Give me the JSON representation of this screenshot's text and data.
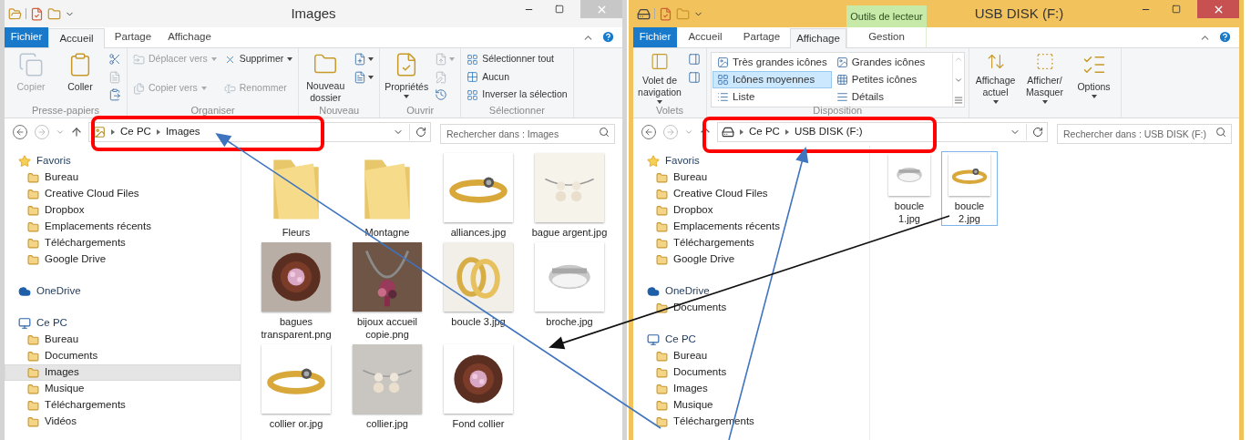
{
  "windows": [
    {
      "title": "Images",
      "active": false,
      "tabs": [
        {
          "label": "Fichier",
          "kind": "file",
          "selected": false
        },
        {
          "label": "Accueil",
          "kind": "normal",
          "selected": true
        },
        {
          "label": "Partage",
          "kind": "normal",
          "selected": false
        },
        {
          "label": "Affichage",
          "kind": "normal",
          "selected": false
        }
      ],
      "ribbon": [
        {
          "label": "Presse-papiers",
          "kind": "buttons",
          "items": [
            {
              "label": "Copier",
              "kind": "large",
              "disabled": true,
              "dropdown": false
            },
            {
              "label": "Coller",
              "kind": "large",
              "disabled": false,
              "dropdown": false
            },
            {
              "kind": "icon",
              "disabled": false,
              "dropdown": false
            },
            {
              "kind": "icon",
              "disabled": true,
              "dropdown": false
            },
            {
              "kind": "icon",
              "disabled": false,
              "dropdown": false
            }
          ]
        },
        {
          "label": "Organiser",
          "kind": "buttons",
          "items": [
            {
              "label": "Déplacer vers",
              "kind": "small",
              "disabled": true,
              "dropdown": true
            },
            {
              "label": "Copier vers",
              "kind": "small",
              "disabled": true,
              "dropdown": true
            },
            {
              "label": "Supprimer",
              "kind": "small",
              "disabled": false,
              "dropdown": true
            },
            {
              "label": "Renommer",
              "kind": "small",
              "disabled": true,
              "dropdown": false
            }
          ]
        },
        {
          "label": "Nouveau",
          "kind": "buttons",
          "items": [
            {
              "label": "Nouveau dossier",
              "kind": "large",
              "disabled": false,
              "dropdown": false
            },
            {
              "kind": "icon",
              "disabled": false,
              "dropdown": true
            },
            {
              "kind": "icon",
              "disabled": false,
              "dropdown": true
            }
          ]
        },
        {
          "label": "Ouvrir",
          "kind": "buttons",
          "items": [
            {
              "label": "Propriétés",
              "kind": "large",
              "disabled": false,
              "dropdown": true
            },
            {
              "kind": "icon",
              "disabled": true,
              "dropdown": true
            },
            {
              "kind": "icon",
              "disabled": true,
              "dropdown": false
            },
            {
              "kind": "icon",
              "disabled": false,
              "dropdown": false
            }
          ]
        },
        {
          "label": "Sélectionner",
          "kind": "buttons",
          "items": [
            {
              "label": "Sélectionner tout",
              "kind": "small",
              "disabled": false,
              "dropdown": false
            },
            {
              "label": "Aucun",
              "kind": "small",
              "disabled": false,
              "dropdown": false
            },
            {
              "label": "Inverser la sélection",
              "kind": "small",
              "disabled": false,
              "dropdown": false
            }
          ]
        }
      ],
      "address": {
        "crumbs": [
          "Ce PC",
          "Images"
        ]
      },
      "search": {
        "placeholder": "Rechercher dans : Images"
      },
      "nav": [
        {
          "label": "Favoris",
          "selected": false,
          "children": [
            {
              "label": "Bureau",
              "selected": false
            },
            {
              "label": "Creative Cloud Files",
              "selected": false
            },
            {
              "label": "Dropbox",
              "selected": false
            },
            {
              "label": "Emplacements récents",
              "selected": false
            },
            {
              "label": "Téléchargements",
              "selected": false
            },
            {
              "label": "Google Drive",
              "selected": false
            }
          ]
        },
        {
          "label": "OneDrive",
          "selected": false
        },
        {
          "label": "Ce PC",
          "selected": false,
          "children": [
            {
              "label": "Bureau",
              "selected": false
            },
            {
              "label": "Documents",
              "selected": false
            },
            {
              "label": "Images",
              "selected": true
            },
            {
              "label": "Musique",
              "selected": false
            },
            {
              "label": "Téléchargements",
              "selected": false
            },
            {
              "label": "Vidéos",
              "selected": false
            }
          ]
        }
      ],
      "files": [
        {
          "name": "Fleurs",
          "kind": "folder",
          "selected": false
        },
        {
          "name": "Montagne",
          "kind": "folder",
          "selected": false
        },
        {
          "name": "alliances.jpg",
          "kind": "picture",
          "selected": false
        },
        {
          "name": "bague argent.jpg",
          "kind": "picture",
          "selected": false
        },
        {
          "name": "bagues transparent.png",
          "kind": "picture",
          "selected": false
        },
        {
          "name": "bijoux accueil copie.png",
          "kind": "picture",
          "selected": false
        },
        {
          "name": "boucle 3.jpg",
          "kind": "picture",
          "selected": false
        },
        {
          "name": "broche.jpg",
          "kind": "picture",
          "selected": false
        },
        {
          "name": "collier or.jpg",
          "kind": "picture",
          "selected": false
        },
        {
          "name": "collier.jpg",
          "kind": "picture",
          "selected": false
        },
        {
          "name": "Fond collier",
          "kind": "picture",
          "selected": false
        }
      ]
    },
    {
      "title": "USB DISK (F:)",
      "active": true,
      "tabs": [
        {
          "label": "Fichier",
          "kind": "file",
          "selected": false
        },
        {
          "label": "Accueil",
          "kind": "normal",
          "selected": false
        },
        {
          "label": "Partage",
          "kind": "normal",
          "selected": false
        },
        {
          "label": "Affichage",
          "kind": "normal",
          "selected": true
        },
        {
          "label": "Gestion",
          "kind": "context",
          "context": "Outils de lecteur",
          "selected": false
        }
      ],
      "ribbon": [
        {
          "label": "Volets",
          "kind": "buttons",
          "items": [
            {
              "label": "Volet de navigation",
              "kind": "large",
              "disabled": false,
              "dropdown": true
            },
            {
              "kind": "icon",
              "disabled": false,
              "dropdown": false
            },
            {
              "kind": "icon",
              "disabled": false,
              "dropdown": false
            }
          ]
        },
        {
          "label": "Disposition",
          "kind": "gallery",
          "items": [
            {
              "label": "Très grandes icônes",
              "selected": false
            },
            {
              "label": "Grandes icônes",
              "selected": false
            },
            {
              "label": "Icônes moyennes",
              "selected": true
            },
            {
              "label": "Petites icônes",
              "selected": false
            },
            {
              "label": "Liste",
              "selected": false
            },
            {
              "label": "Détails",
              "selected": false
            }
          ]
        },
        {
          "kind": "buttons",
          "items": [
            {
              "label": "Affichage actuel",
              "kind": "large",
              "disabled": false,
              "dropdown": true
            },
            {
              "label": "Afficher/ Masquer",
              "kind": "large",
              "disabled": false,
              "dropdown": true
            },
            {
              "label": "Options",
              "kind": "large",
              "disabled": false,
              "dropdown": true
            }
          ]
        }
      ],
      "address": {
        "crumbs": [
          "Ce PC",
          "USB DISK (F:)"
        ]
      },
      "search": {
        "placeholder": "Rechercher dans : USB DISK (F:)"
      },
      "nav": [
        {
          "label": "Favoris",
          "selected": false,
          "children": [
            {
              "label": "Bureau",
              "selected": false
            },
            {
              "label": "Creative Cloud Files",
              "selected": false
            },
            {
              "label": "Dropbox",
              "selected": false
            },
            {
              "label": "Emplacements récents",
              "selected": false
            },
            {
              "label": "Téléchargements",
              "selected": false
            },
            {
              "label": "Google Drive",
              "selected": false
            }
          ]
        },
        {
          "label": "OneDrive",
          "selected": false,
          "children": [
            {
              "label": "Documents",
              "selected": false
            }
          ]
        },
        {
          "label": "Ce PC",
          "selected": false,
          "children": [
            {
              "label": "Bureau",
              "selected": false
            },
            {
              "label": "Documents",
              "selected": false
            },
            {
              "label": "Images",
              "selected": false
            },
            {
              "label": "Musique",
              "selected": false
            },
            {
              "label": "Téléchargements",
              "selected": false
            }
          ]
        }
      ],
      "files": [
        {
          "name": "boucle 1.jpg",
          "kind": "picture",
          "selected": false
        },
        {
          "name": "boucle 2.jpg",
          "kind": "picture",
          "selected": true
        }
      ]
    }
  ]
}
